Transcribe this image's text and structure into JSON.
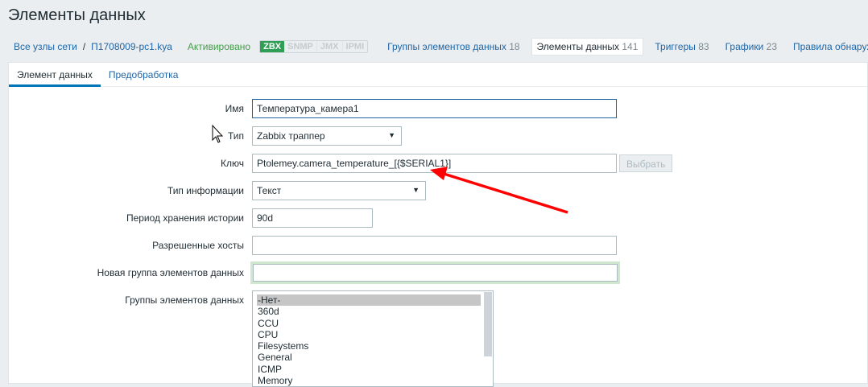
{
  "page_title": "Элементы данных",
  "nav": {
    "all_hosts": "Все узлы сети",
    "host": "П1708009-pc1.kya",
    "status": "Активировано",
    "badges": [
      "ZBX",
      "SNMP",
      "JMX",
      "IPMI"
    ],
    "items": [
      {
        "label": "Группы элементов данных",
        "count": "18"
      },
      {
        "label": "Элементы данных",
        "count": "141"
      },
      {
        "label": "Триггеры",
        "count": "83"
      },
      {
        "label": "Графики",
        "count": "23"
      },
      {
        "label": "Правила обнаружения",
        "count": ""
      }
    ]
  },
  "tabs": [
    "Элемент данных",
    "Предобработка"
  ],
  "form": {
    "name_label": "Имя",
    "name_value": "Температура_камера1",
    "type_label": "Тип",
    "type_value": "Zabbix траппер",
    "key_label": "Ключ",
    "key_value": "Ptolemey.camera_temperature_[{$SERIAL1}]",
    "select_button": "Выбрать",
    "info_type_label": "Тип информации",
    "info_type_value": "Текст",
    "history_label": "Период хранения истории",
    "history_value": "90d",
    "allowed_hosts_label": "Разрешенные хосты",
    "allowed_hosts_value": "",
    "new_app_label": "Новая группа элементов данных",
    "new_app_value": "",
    "apps_label": "Группы элементов данных",
    "apps": [
      "-Нет-",
      "360d",
      "CCU",
      "CPU",
      "Filesystems",
      "General",
      "ICMP",
      "Memory"
    ]
  },
  "colors": {
    "arrow": "#ff0000",
    "accent": "#0275b8",
    "zbx": "#2f9f55"
  }
}
